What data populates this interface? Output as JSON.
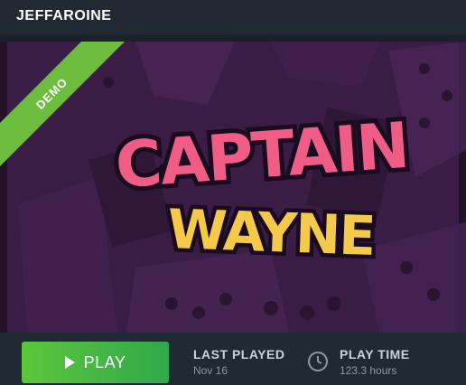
{
  "header": {
    "title": "JEFFAROINE"
  },
  "hero": {
    "ribbon": "DEMO",
    "logo_line1": "CAPTAIN",
    "logo_line2": "WAYNE"
  },
  "actions": {
    "play_label": "PLAY",
    "last_played_title": "LAST PLAYED",
    "last_played_value": "Nov 16",
    "play_time_title": "PLAY TIME",
    "play_time_value": "123.3 hours"
  },
  "colors": {
    "play_green": "#5cc63b",
    "ribbon_green": "#6dbd3f",
    "logo_pink": "#ef5d86",
    "logo_yellow": "#f5c94a",
    "bg_purple": "#3b1d44"
  }
}
